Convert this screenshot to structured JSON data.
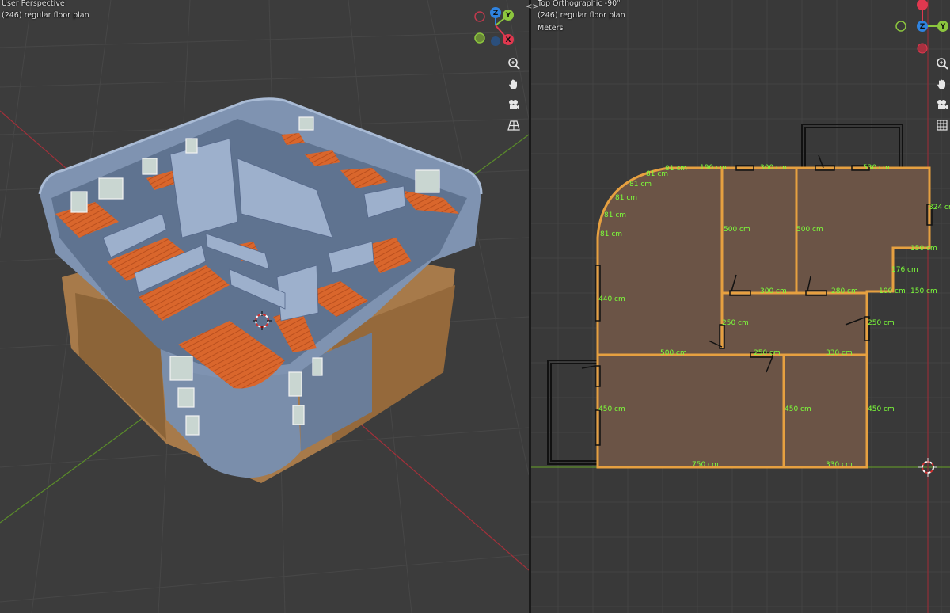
{
  "left_viewport": {
    "view_name": "User Perspective",
    "collection_label": "(246) regular floor plan"
  },
  "right_viewport": {
    "view_name": "Top Orthographic -90°",
    "collection_label": "(246) regular floor plan",
    "units": "Meters"
  },
  "gizmo": {
    "x": "X",
    "y": "Y",
    "z": "Z",
    "colors": {
      "x": "#e0384f",
      "y": "#8cc63e",
      "z": "#2f83e0"
    }
  },
  "split_toggle": "<>",
  "nav_icons": [
    "zoom-icon",
    "hand-pan-icon",
    "camera-icon",
    "grid-perspective-icon"
  ],
  "dimensions": {
    "top_arc": [
      "81 cm",
      "81 cm",
      "81 cm",
      "81 cm",
      "81 cm",
      "81 cm"
    ],
    "top": [
      "190 cm",
      "300 cm",
      "530 cm"
    ],
    "right": [
      "324 cm",
      "150 cm",
      "176 cm",
      "150 cm"
    ],
    "middle": [
      "500 cm",
      "500 cm",
      "300 cm",
      "280 cm",
      "100 cm"
    ],
    "left": [
      "440 cm",
      "450 cm"
    ],
    "center": [
      "250 cm",
      "250 cm",
      "500 cm",
      "250 cm",
      "330 cm"
    ],
    "lower": [
      "450 cm",
      "450 cm"
    ],
    "bottom": [
      "750 cm",
      "330 cm"
    ]
  },
  "colors": {
    "floor_wood": "#d9662c",
    "wall_blue": "#7387a5",
    "plan_fill": "#6b5446",
    "wall_outline": "#e6a040",
    "dimension_text": "#7dff3a"
  }
}
